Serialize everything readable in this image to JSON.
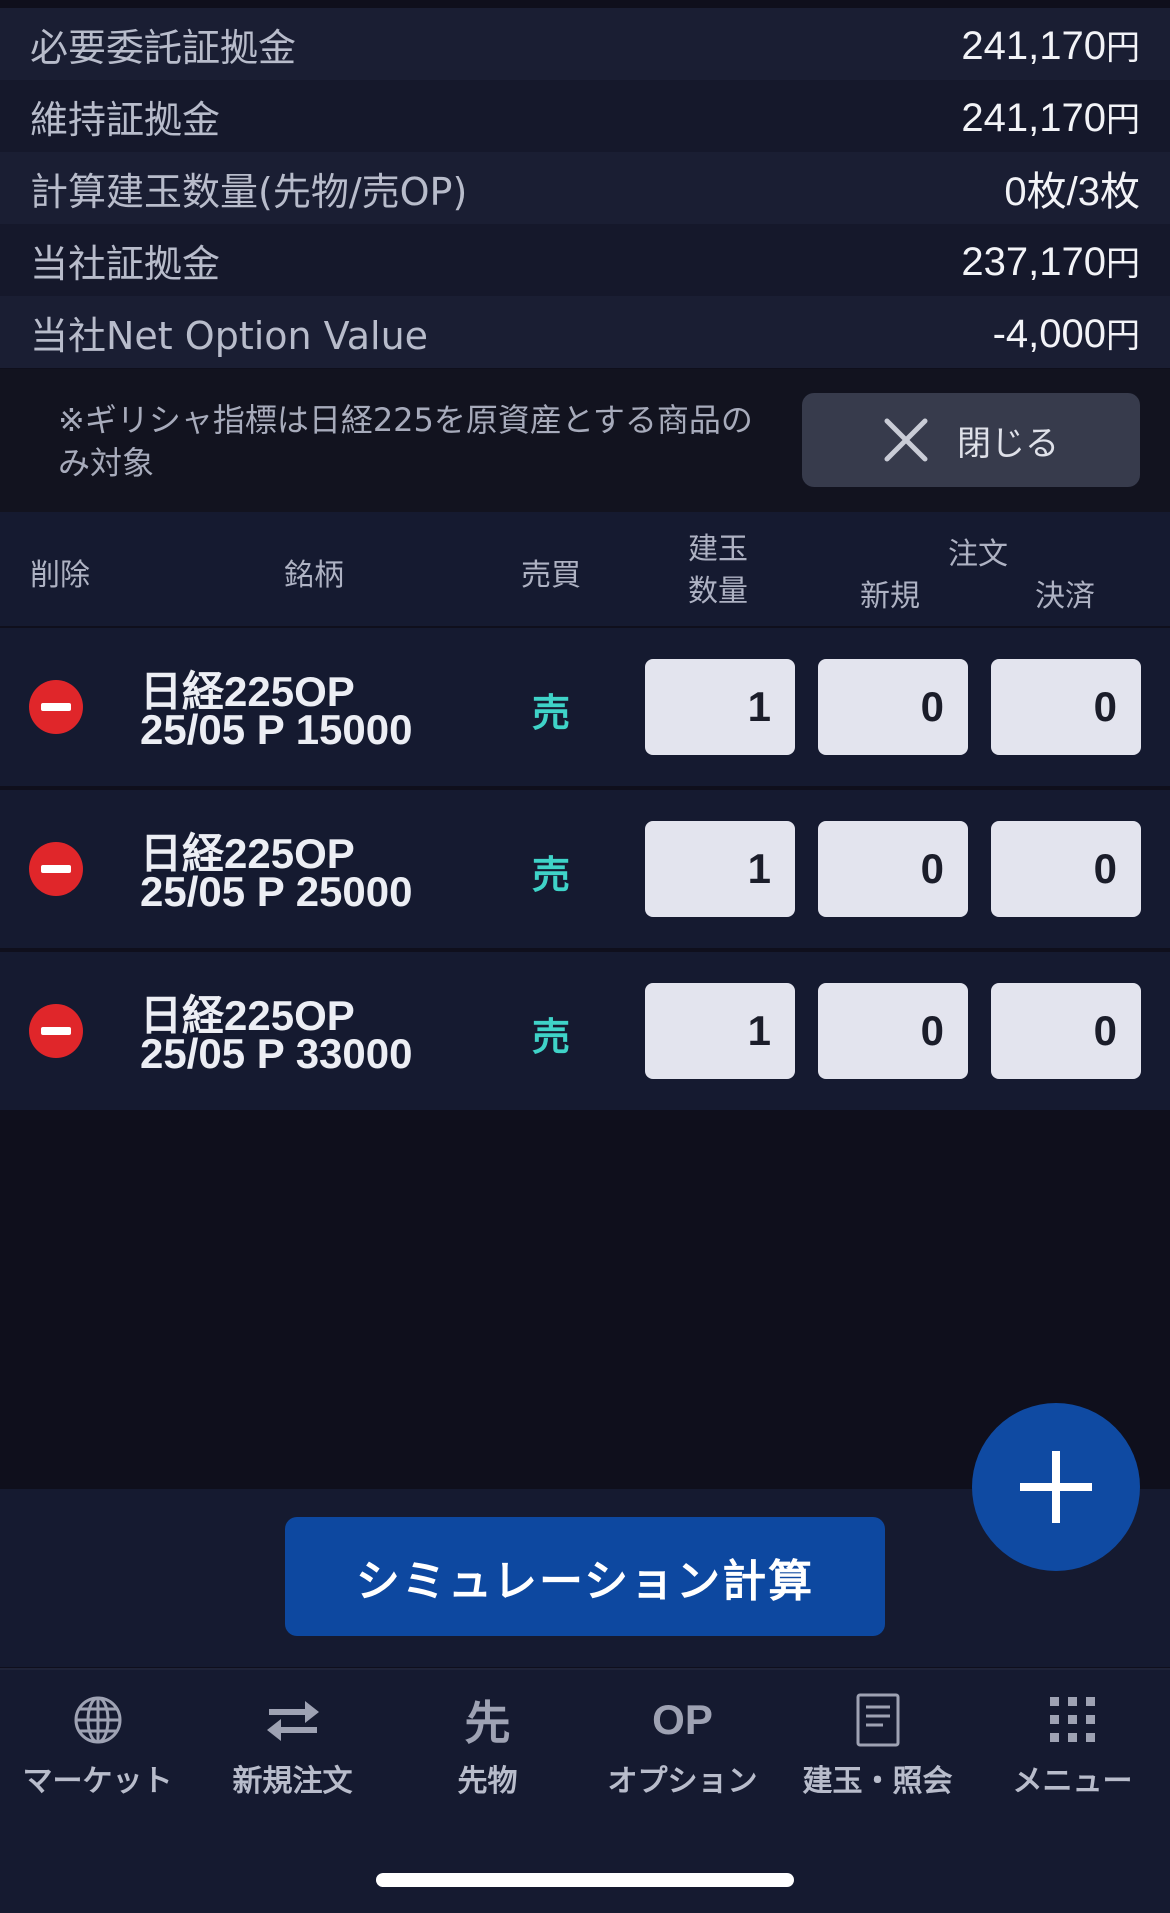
{
  "summary": [
    {
      "label": "必要委託証拠金",
      "value": "241,170",
      "unit": "円"
    },
    {
      "label": "維持証拠金",
      "value": "241,170",
      "unit": "円"
    },
    {
      "label": "計算建玉数量(先物/売OP)",
      "value": "0枚/3枚",
      "unit": ""
    },
    {
      "label": "当社証拠金",
      "value": "237,170",
      "unit": "円"
    },
    {
      "label": "当社Net Option Value",
      "value": "-4,000",
      "unit": "円"
    }
  ],
  "note": {
    "text": "※ギリシャ指標は日経225を原資産とする商品のみ対象",
    "close_label": "閉じる"
  },
  "table_header": {
    "delete": "削除",
    "issue": "銘柄",
    "side": "売買",
    "position_qty": "建玉数量",
    "order": "注文",
    "new": "新規",
    "settle": "決済"
  },
  "rows": [
    {
      "name": "日経225OP",
      "detail": "25/05 P 15000",
      "side": "売",
      "position": "1",
      "new": "0",
      "settle": "0"
    },
    {
      "name": "日経225OP",
      "detail": "25/05 P 25000",
      "side": "売",
      "position": "1",
      "new": "0",
      "settle": "0"
    },
    {
      "name": "日経225OP",
      "detail": "25/05 P 33000",
      "side": "売",
      "position": "1",
      "new": "0",
      "settle": "0"
    }
  ],
  "simulate_button": "シミュレーション計算",
  "add_icon": "plus-icon",
  "tabs": [
    {
      "label": "マーケット",
      "icon": "globe-icon"
    },
    {
      "label": "新規注文",
      "icon": "swap-arrows-icon"
    },
    {
      "label": "先物",
      "icon": "futures-icon"
    },
    {
      "label": "オプション",
      "icon": "option-icon"
    },
    {
      "label": "建玉・照会",
      "icon": "document-icon"
    },
    {
      "label": "メニュー",
      "icon": "grid-menu-icon"
    }
  ],
  "colors": {
    "accent": "#0d48a0",
    "sell": "#3fd3c8",
    "delete": "#e0262a",
    "background": "#0f0f1c",
    "panel": "#151a30"
  }
}
